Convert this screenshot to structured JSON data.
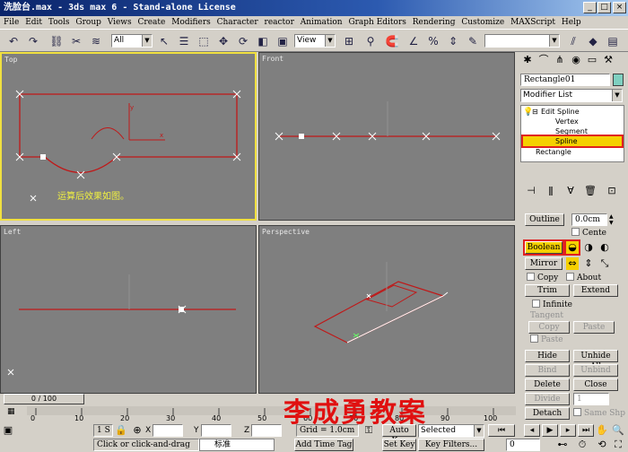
{
  "window": {
    "title": "洗脸台.max - 3ds max 6 - Stand-alone License",
    "min": "_",
    "max": "□",
    "close": "×"
  },
  "menu": [
    "File",
    "Edit",
    "Tools",
    "Group",
    "Views",
    "Create",
    "Modifiers",
    "Character",
    "reactor",
    "Animation",
    "Graph Editors",
    "Rendering",
    "Customize",
    "MAXScript",
    "Help"
  ],
  "toolbar": {
    "selection_filter": "All",
    "ref_coord": "View",
    "named_selection": ""
  },
  "viewports": {
    "top": {
      "label": "Top",
      "annotation": "运算后效果如图。"
    },
    "front": {
      "label": "Front"
    },
    "left": {
      "label": "Left"
    },
    "perspective": {
      "label": "Perspective"
    }
  },
  "panel": {
    "object_name": "Rectangle01",
    "object_color": "#7fd0c0",
    "modifier_list": "Modifier List",
    "stack": [
      {
        "label": "Edit Spline",
        "icon": "lightbulb-icon"
      },
      {
        "label": "Vertex"
      },
      {
        "label": "Segment"
      },
      {
        "label": "Spline",
        "selected": true
      },
      {
        "label": "Rectangle"
      }
    ],
    "outline_label": "Outline",
    "outline_value": "0.0cm",
    "center_label": "Cente",
    "boolean_label": "Boolean",
    "mirror_label": "Mirror",
    "copy_label": "Copy",
    "about_label": "About",
    "trim_label": "Trim",
    "extend_label": "Extend",
    "infinite_label": "Infinite",
    "tangent_label": "Tangent",
    "tan_copy_label": "Copy",
    "tan_paste_label": "Paste",
    "paste_length_label": "Paste",
    "hide_label": "Hide",
    "unhide_all_label": "Unhide All",
    "bind_label": "Bind",
    "unbind_label": "Unbind",
    "delete_label": "Delete",
    "close_label": "Close",
    "divide_label": "Divide",
    "divide_value": "1",
    "detach_label": "Detach",
    "same_shp_label": "Same Shp"
  },
  "timeline": {
    "position": "0 / 100",
    "ticks": [
      "0",
      "10",
      "20",
      "30",
      "40",
      "50",
      "60",
      "70",
      "80",
      "90",
      "100"
    ]
  },
  "watermark": "李成勇教案",
  "status": {
    "selected_count": "1 S",
    "x_label": "X",
    "y_label": "Y",
    "z_label": "Z",
    "grid": "Grid = 1.0cm",
    "prompt": "Click or click-and-drag",
    "ime": "标准",
    "add_time_tag": "Add Time Tag",
    "auto_key": "Auto Key",
    "set_key": "Set Key",
    "key_mode": "Selected",
    "key_filters": "Key Filters...",
    "frame": "0"
  },
  "colors": {
    "spline": "#c01818",
    "viewport_bg": "#7f7f7f",
    "active_border": "#f0e040",
    "annotation": "#f0f040",
    "watermark": "#e01010"
  }
}
